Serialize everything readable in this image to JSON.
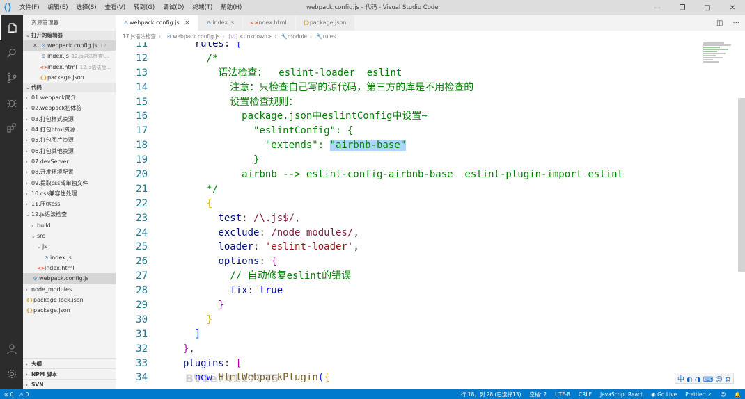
{
  "titlebar": {
    "menus": [
      "文件(F)",
      "编辑(E)",
      "选择(S)",
      "查看(V)",
      "转到(G)",
      "调试(D)",
      "终端(T)",
      "帮助(H)"
    ],
    "title": "webpack.config.js - 代码 - Visual Studio Code",
    "controls": [
      "—",
      "❐",
      "□",
      "✕"
    ]
  },
  "sidebar": {
    "header": "资源管理器",
    "open_editors_label": "打开的编辑器",
    "open_editors": [
      {
        "name": "webpack.config.js",
        "desc": "12...",
        "icon": "cfg"
      },
      {
        "name": "index.js",
        "desc": "12.js语法检查\\...",
        "icon": "js"
      },
      {
        "name": "index.html",
        "desc": "12.js语法检...",
        "icon": "html"
      },
      {
        "name": "package.json",
        "desc": "",
        "icon": "json"
      }
    ],
    "folder_label": "代码",
    "tree": [
      {
        "name": "01.webpack简介",
        "depth": 1,
        "type": "folder"
      },
      {
        "name": "02.webpack初体验",
        "depth": 1,
        "type": "folder"
      },
      {
        "name": "03.打包样式资源",
        "depth": 1,
        "type": "folder"
      },
      {
        "name": "04.打包html资源",
        "depth": 1,
        "type": "folder"
      },
      {
        "name": "05.打包图片资源",
        "depth": 1,
        "type": "folder"
      },
      {
        "name": "06.打包其他资源",
        "depth": 1,
        "type": "folder"
      },
      {
        "name": "07.devServer",
        "depth": 1,
        "type": "folder"
      },
      {
        "name": "08.开发环境配置",
        "depth": 1,
        "type": "folder"
      },
      {
        "name": "09.提取css成单独文件",
        "depth": 1,
        "type": "folder"
      },
      {
        "name": "10.css兼容性处理",
        "depth": 1,
        "type": "folder"
      },
      {
        "name": "11.压缩css",
        "depth": 1,
        "type": "folder"
      },
      {
        "name": "12.js语法检查",
        "depth": 1,
        "type": "folder-open"
      },
      {
        "name": "build",
        "depth": 2,
        "type": "folder"
      },
      {
        "name": "src",
        "depth": 2,
        "type": "folder-open"
      },
      {
        "name": "js",
        "depth": 3,
        "type": "folder-open"
      },
      {
        "name": "index.js",
        "depth": 4,
        "type": "js"
      },
      {
        "name": "index.html",
        "depth": 3,
        "type": "html"
      },
      {
        "name": "webpack.config.js",
        "depth": 2,
        "type": "cfg",
        "selected": true
      },
      {
        "name": "node_modules",
        "depth": 1,
        "type": "folder"
      },
      {
        "name": "package-lock.json",
        "depth": 1,
        "type": "json"
      },
      {
        "name": "package.json",
        "depth": 1,
        "type": "json"
      }
    ],
    "bottom_sections": [
      "大纲",
      "NPM 脚本",
      "SVN"
    ]
  },
  "tabs": [
    {
      "label": "webpack.config.js",
      "icon": "cfg",
      "active": true
    },
    {
      "label": "index.js",
      "icon": "js",
      "active": false
    },
    {
      "label": "index.html",
      "icon": "html",
      "active": false
    },
    {
      "label": "package.json",
      "icon": "json",
      "active": false
    }
  ],
  "breadcrumb": [
    "17.js语法检查",
    "webpack.config.js",
    "<unknown>",
    "module",
    "rules"
  ],
  "editor": {
    "line_numbers": [
      "11",
      "12",
      "13",
      "14",
      "15",
      "16",
      "17",
      "18",
      "19",
      "20",
      "21",
      "22",
      "23",
      "24",
      "25",
      "26",
      "27",
      "28",
      "29",
      "30",
      "31",
      "32",
      "33",
      "34"
    ]
  },
  "ime": "中 ◐ ◑ ⌨ ☺ ⚙",
  "watermark": "BV1e741177T5",
  "statusbar": {
    "errors": "⊗ 0",
    "warnings": "⚠ 0",
    "position": "行 18，列 28 (已选择13)",
    "spaces": "空格: 2",
    "encoding": "UTF-8",
    "eol": "CRLF",
    "language": "JavaScript React",
    "golive": "Go Live",
    "prettier": "Prettier: ✓"
  }
}
